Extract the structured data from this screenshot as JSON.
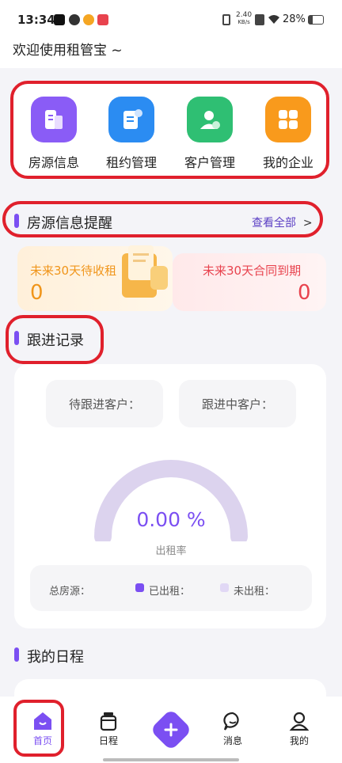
{
  "status_bar": {
    "time": "13:34",
    "net_speed": "2.40",
    "net_unit": "KB/s",
    "battery": "28%"
  },
  "header": {
    "welcome": "欢迎使用租管宝 ~"
  },
  "quick_actions": [
    {
      "label": "房源信息",
      "icon": "building-icon",
      "color": "#8a5cf6"
    },
    {
      "label": "租约管理",
      "icon": "contract-icon",
      "color": "#2b8cf2"
    },
    {
      "label": "客户管理",
      "icon": "customer-icon",
      "color": "#2fbf73"
    },
    {
      "label": "我的企业",
      "icon": "grid-icon",
      "color": "#f99a1c"
    }
  ],
  "reminder": {
    "title": "房源信息提醒",
    "view_all": "查看全部",
    "view_all_arrow": ">",
    "rent_label": "未来30天待收租",
    "rent_value": "0",
    "expire_label": "未来30天合同到期",
    "expire_value": "0"
  },
  "follow": {
    "title": "跟进记录",
    "pending": "待跟进客户：",
    "ongoing": "跟进中客户：",
    "rate_value": "0.00 %",
    "rate_label": "出租率",
    "total": "总房源：",
    "rented": "已出租：",
    "unrented": "未出租：",
    "rate_fraction": 0
  },
  "schedule": {
    "title": "我的日程"
  },
  "bottom_nav": [
    {
      "label": "首页",
      "icon": "home-icon"
    },
    {
      "label": "日程",
      "icon": "calendar-icon"
    },
    {
      "label": "",
      "icon": "add-icon"
    },
    {
      "label": "消息",
      "icon": "message-icon"
    },
    {
      "label": "我的",
      "icon": "profile-icon"
    }
  ],
  "colors": {
    "accent": "#7b4ff2",
    "highlight_red": "#e0202c",
    "orange": "#f0951a",
    "red_text": "#e8434e"
  }
}
